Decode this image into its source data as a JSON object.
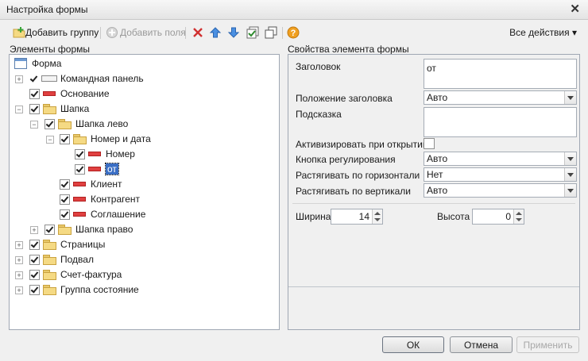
{
  "window": {
    "title": "Настройка формы"
  },
  "toolbar": {
    "add_group_label": "Добавить группу",
    "add_fields_label": "Добавить поля",
    "all_actions_label": "Все действия ▾"
  },
  "left": {
    "header": "Элементы формы",
    "tree": [
      {
        "label": "Форма"
      },
      {
        "label": "Командная панель"
      },
      {
        "label": "Основание"
      },
      {
        "label": "Шапка"
      },
      {
        "label": "Шапка лево"
      },
      {
        "label": "Номер и дата"
      },
      {
        "label": "Номер"
      },
      {
        "label": "от"
      },
      {
        "label": "Клиент"
      },
      {
        "label": "Контрагент"
      },
      {
        "label": "Соглашение"
      },
      {
        "label": "Шапка право"
      },
      {
        "label": "Страницы"
      },
      {
        "label": "Подвал"
      },
      {
        "label": "Счет-фактура"
      },
      {
        "label": "Группа состояние"
      }
    ]
  },
  "right": {
    "header": "Свойства элемента формы",
    "title_label": "Заголовок",
    "title_value": "от",
    "title_pos_label": "Положение заголовка",
    "title_pos_value": "Авто",
    "hint_label": "Подсказка",
    "hint_value": "",
    "activate_label": "Активизировать при открытии",
    "activate_checked": false,
    "adjust_btn_label": "Кнопка регулирования",
    "adjust_btn_value": "Авто",
    "stretch_h_label": "Растягивать по горизонтали",
    "stretch_h_value": "Нет",
    "stretch_v_label": "Растягивать по вертикали",
    "stretch_v_value": "Авто",
    "width_label": "Ширина",
    "width_value": "14",
    "height_label": "Высота",
    "height_value": "0"
  },
  "buttons": {
    "ok": "ОК",
    "cancel": "Отмена",
    "apply": "Применить"
  },
  "colors": {
    "selection": "#3a6ec4",
    "delete_red": "#d03030",
    "arrow_blue": "#3a7bd5",
    "help_orange": "#f0a020"
  },
  "icons": [
    "add-group-icon",
    "add-fields-icon",
    "delete-icon",
    "move-up-icon",
    "move-down-icon",
    "check-all-icon",
    "copy-icon",
    "help-icon"
  ]
}
